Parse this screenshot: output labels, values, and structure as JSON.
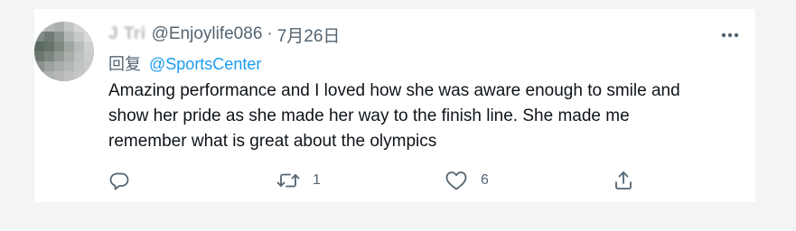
{
  "tweet": {
    "display_name": "J Tri",
    "handle": "@Enjoylife086",
    "separator": "·",
    "date": "7月26日",
    "reply_prefix": "回复",
    "reply_to": "@SportsCenter",
    "text_lines": [
      "Amazing performance and I loved how she was aware enough to smile and",
      "show her pride as she made her way to the finish line. She made me",
      "remember what is great about the olympics"
    ],
    "reply_count": "",
    "retweet_count": "1",
    "like_count": "6"
  },
  "icons": {
    "more": "more-dots-icon",
    "reply": "speech-bubble-icon",
    "retweet": "retweet-arrows-icon",
    "like": "heart-outline-icon",
    "share": "share-upload-icon"
  },
  "colors": {
    "link": "#1d9bf0",
    "text": "#0f1419",
    "secondary": "#536471",
    "background": "#f3f4f5"
  }
}
